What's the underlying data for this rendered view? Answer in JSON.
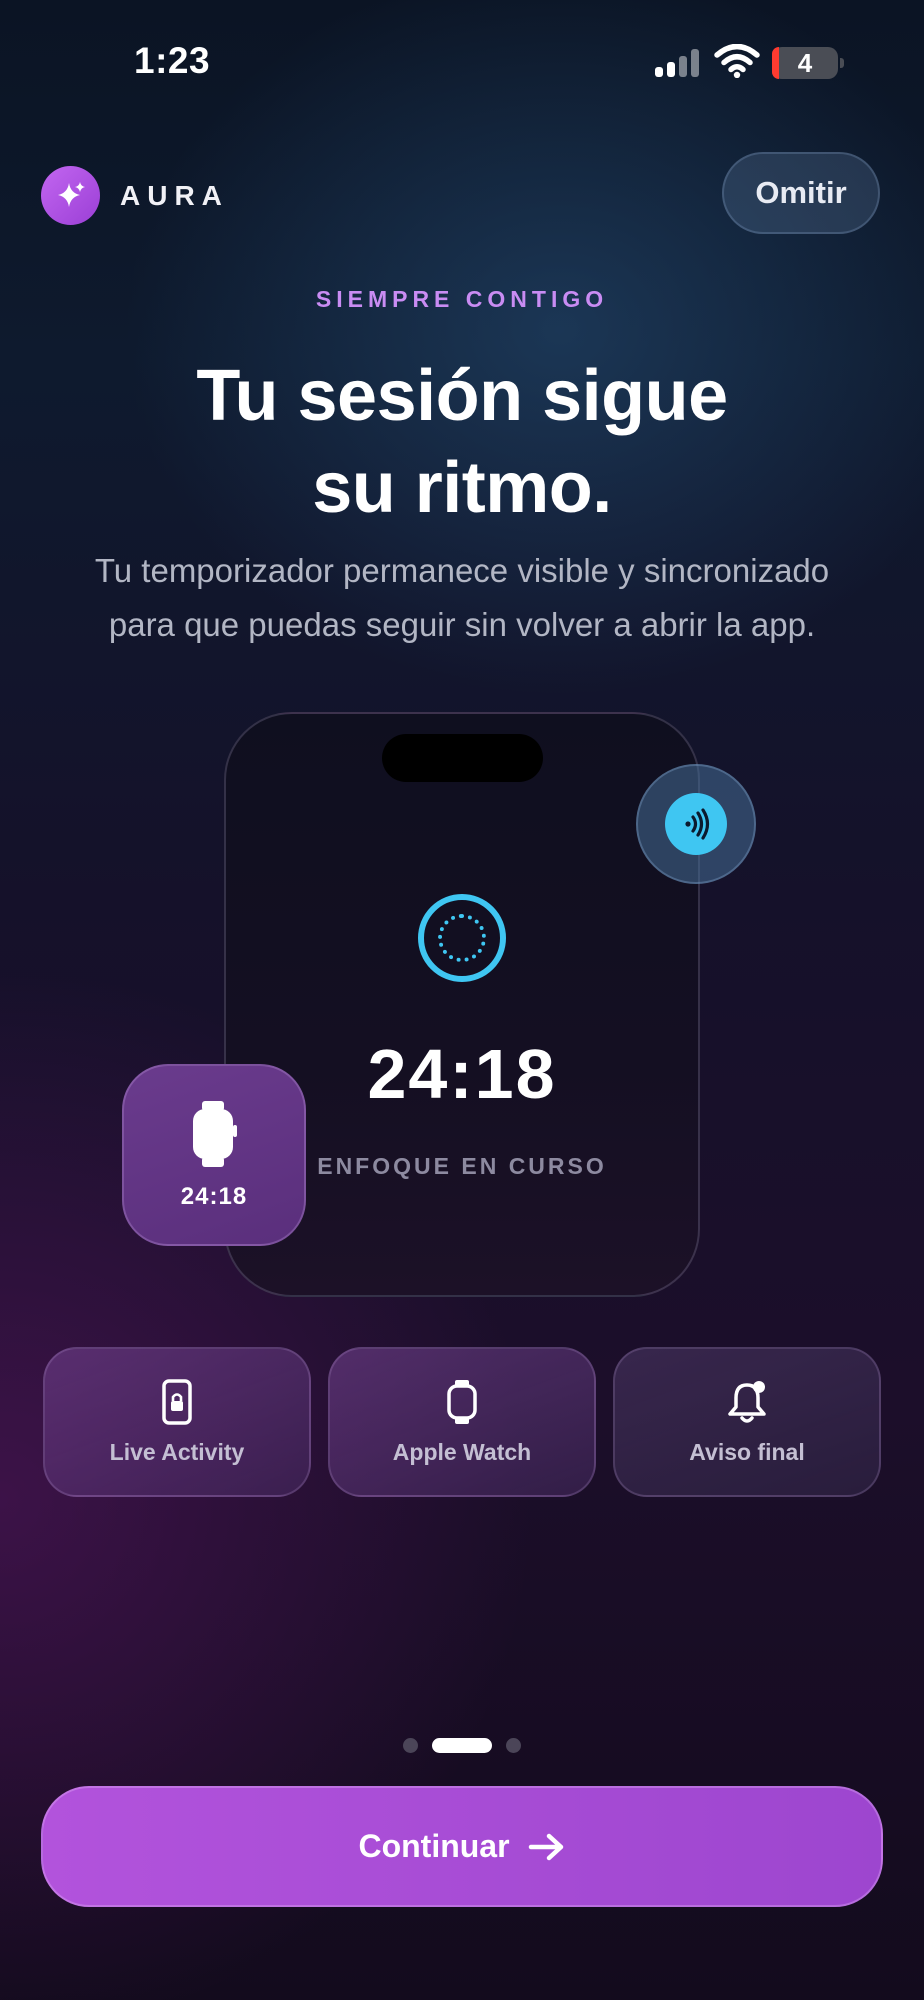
{
  "status_bar": {
    "time": "1:23",
    "battery_level": "4"
  },
  "header": {
    "brand": "AURA",
    "skip_label": "Omitir"
  },
  "hero": {
    "eyebrow": "SIEMPRE CONTIGO",
    "title_line1": "Tu sesión sigue",
    "title_line2": "su ritmo.",
    "subtitle_line1": "Tu temporizador permanece visible y sincronizado",
    "subtitle_line2": "para que puedas seguir sin volver a abrir la app."
  },
  "mockup": {
    "timer": "24:18",
    "caption": "ENFOQUE EN CURSO",
    "watch_timer": "24:18"
  },
  "features": [
    {
      "label": "Live Activity",
      "icon": "lock-phone-icon"
    },
    {
      "label": "Apple Watch",
      "icon": "watch-icon"
    },
    {
      "label": "Aviso final",
      "icon": "bell-icon"
    }
  ],
  "pager": {
    "total": 3,
    "active": 2
  },
  "cta": {
    "label": "Continuar"
  },
  "colors": {
    "accent": "#b253dc",
    "cyan": "#3fc6f2",
    "eyebrow": "#c98cf3"
  }
}
